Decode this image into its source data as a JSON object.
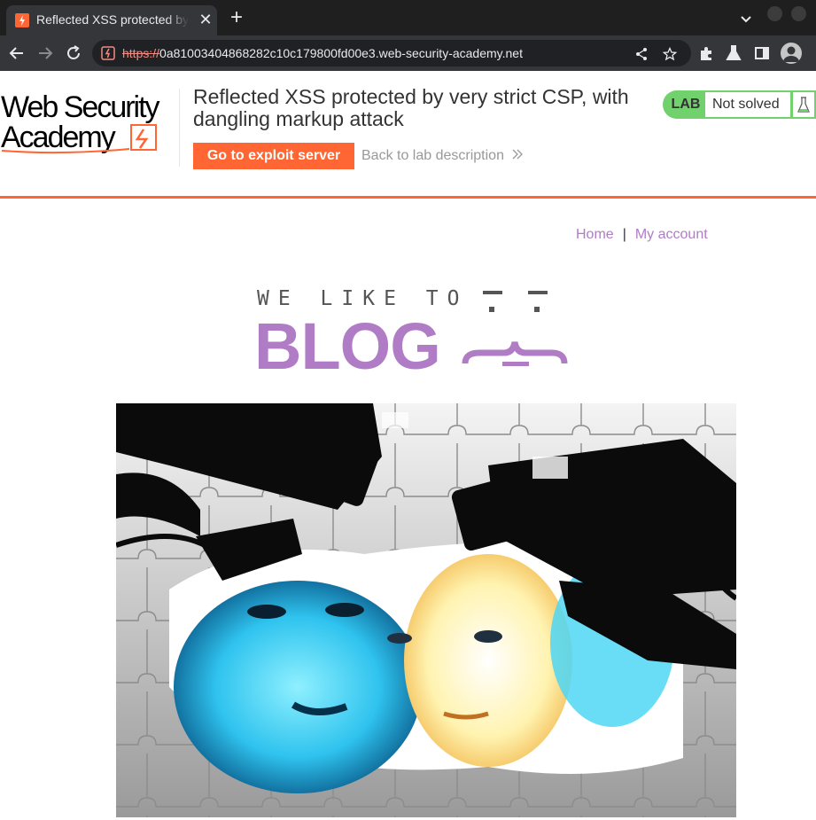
{
  "browser": {
    "tab_title": "Reflected XSS protected by very strict CSP, with dangling markup attack",
    "url_scheme": "https://",
    "url_host": "0a81003404868282c10c179800fd00e3.web-security-academy.net"
  },
  "lab": {
    "logo_line1": "Web Security",
    "logo_line2": "Academy",
    "title": "Reflected XSS protected by very strict CSP, with dangling markup attack",
    "exploit_button": "Go to exploit server",
    "back_link": "Back to lab description",
    "status_badge": "LAB",
    "status_text": "Not solved",
    "accent_color": "#ff6633",
    "status_color": "#70d16d"
  },
  "nav": {
    "home": "Home",
    "separator": "|",
    "my_account": "My account"
  },
  "blog_logo": {
    "tagline": "WE LIKE TO",
    "word": "BLOG",
    "color": "#b07cc6"
  },
  "hero": {
    "description": "Surveillance cameras aimed at faces on a puzzle background"
  }
}
